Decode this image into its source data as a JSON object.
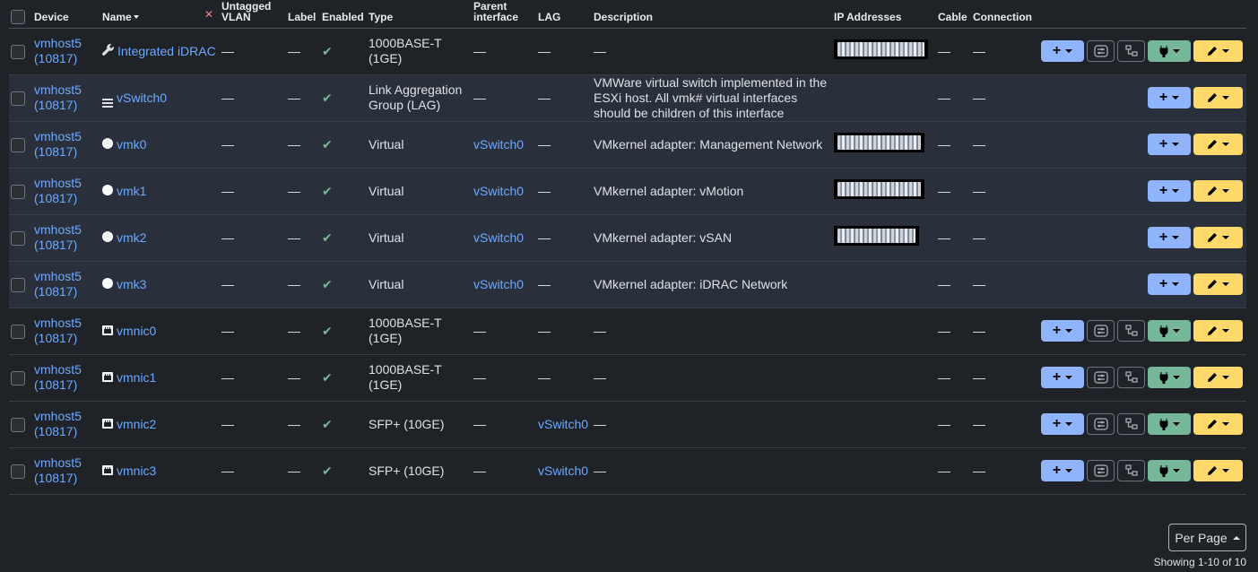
{
  "columns": {
    "device": "Device",
    "name": "Name",
    "untagged_vlan": "Untagged VLAN",
    "label": "Label",
    "enabled": "Enabled",
    "type": "Type",
    "parent": "Parent interface",
    "lag": "LAG",
    "description": "Description",
    "ip": "IP Addresses",
    "cable": "Cable",
    "connection": "Connection"
  },
  "dash": "—",
  "check": "✔",
  "rows": [
    {
      "device": "vmhost5 (10817)",
      "icon": "wrench-icon",
      "name": "Integrated iDRAC",
      "type": "1000BASE-T (1GE)",
      "parent": "—",
      "lag": "—",
      "description": "—",
      "ip": true,
      "ip_width": 105,
      "physical": true,
      "virtual": false
    },
    {
      "device": "vmhost5 (10817)",
      "icon": "lag-icon",
      "name": "vSwitch0",
      "type": "Link Aggregation Group (LAG)",
      "parent": "—",
      "lag": "—",
      "description": "VMWare virtual switch implemented in the ESXi host. All vmk# virtual interfaces should be children of this interface",
      "ip": false,
      "physical": false,
      "virtual": true
    },
    {
      "device": "vmhost5 (10817)",
      "icon": "virtual-icon",
      "name": "vmk0",
      "type": "Virtual",
      "parent": "vSwitch0",
      "lag": "—",
      "description": "VMkernel adapter: Management Network",
      "ip": true,
      "ip_width": 101,
      "physical": false,
      "virtual": true
    },
    {
      "device": "vmhost5 (10817)",
      "icon": "virtual-icon",
      "name": "vmk1",
      "type": "Virtual",
      "parent": "vSwitch0",
      "lag": "—",
      "description": "VMkernel adapter: vMotion",
      "ip": true,
      "ip_width": 101,
      "physical": false,
      "virtual": true
    },
    {
      "device": "vmhost5 (10817)",
      "icon": "virtual-icon",
      "name": "vmk2",
      "type": "Virtual",
      "parent": "vSwitch0",
      "lag": "—",
      "description": "VMkernel adapter: vSAN",
      "ip": true,
      "ip_width": 95,
      "physical": false,
      "virtual": true
    },
    {
      "device": "vmhost5 (10817)",
      "icon": "virtual-icon",
      "name": "vmk3",
      "type": "Virtual",
      "parent": "vSwitch0",
      "lag": "—",
      "description": "VMkernel adapter: iDRAC Network",
      "ip": false,
      "physical": false,
      "virtual": true
    },
    {
      "device": "vmhost5 (10817)",
      "icon": "nic-icon",
      "name": "vmnic0",
      "type": "1000BASE-T (1GE)",
      "parent": "—",
      "lag": "—",
      "description": "—",
      "ip": false,
      "physical": true,
      "virtual": false
    },
    {
      "device": "vmhost5 (10817)",
      "icon": "nic-icon",
      "name": "vmnic1",
      "type": "1000BASE-T (1GE)",
      "parent": "—",
      "lag": "—",
      "description": "—",
      "ip": false,
      "physical": true,
      "virtual": false
    },
    {
      "device": "vmhost5 (10817)",
      "icon": "nic-icon",
      "name": "vmnic2",
      "type": "SFP+ (10GE)",
      "parent": "—",
      "lag": "vSwitch0",
      "description": "—",
      "ip": false,
      "physical": true,
      "virtual": false
    },
    {
      "device": "vmhost5 (10817)",
      "icon": "nic-icon",
      "name": "vmnic3",
      "type": "SFP+ (10GE)",
      "parent": "—",
      "lag": "vSwitch0",
      "description": "—",
      "ip": false,
      "physical": true,
      "virtual": false
    }
  ],
  "pagination": {
    "per_page": "Per Page",
    "showing": "Showing 1-10 of 10"
  },
  "colors": {
    "link": "#6ea8fe",
    "add": "#8fb4fb",
    "edit": "#ffda6a",
    "connect": "#75b798"
  }
}
